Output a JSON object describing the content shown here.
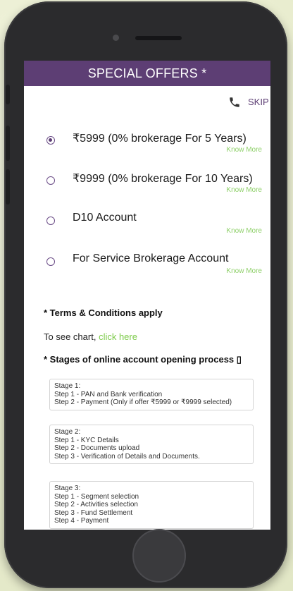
{
  "header": {
    "title": "SPECIAL OFFERS *"
  },
  "topbar": {
    "skip_label": "SKIP",
    "phone_icon": "phone-icon"
  },
  "offers": [
    {
      "label": "₹5999 (0% brokerage For 5 Years)",
      "know_more": "Know More",
      "selected": true
    },
    {
      "label": "₹9999 (0% brokerage For 10 Years)",
      "know_more": "Know More",
      "selected": false
    },
    {
      "label": "D10 Account",
      "know_more": "Know More",
      "selected": false
    },
    {
      "label": "For Service Brokerage Account",
      "know_more": "Know More",
      "selected": false
    }
  ],
  "terms": {
    "text": "* Terms & Conditions apply"
  },
  "chart": {
    "prefix": "To see chart,",
    "link": "click here"
  },
  "stages_title": "* Stages of online account opening process ▯",
  "stages": [
    {
      "title": "Stage 1:",
      "steps": [
        "Step 1 - PAN and Bank verification",
        "Step 2 - Payment (Only if offer ₹5999 or ₹9999 selected)"
      ]
    },
    {
      "title": "Stage 2:",
      "steps": [
        "Step 1 - KYC Details",
        "Step 2 - Documents upload",
        "Step 3 - Verification of Details and Documents."
      ]
    },
    {
      "title": "Stage 3:",
      "steps": [
        "Step 1 - Segment selection",
        "Step 2 - Activities selection",
        "Step 3 - Fund Settlement",
        "Step 4 - Payment"
      ]
    }
  ],
  "colors": {
    "brand": "#5d3e74",
    "link_green": "#7dcb4a",
    "know_more_green": "#8fd06a"
  }
}
